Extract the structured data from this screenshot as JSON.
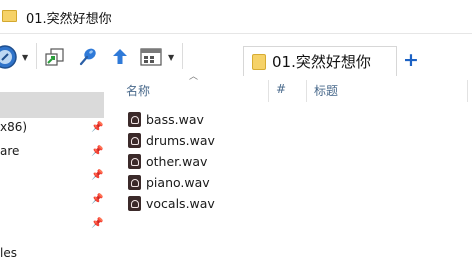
{
  "window": {
    "title": "01.突然好想你"
  },
  "tab": {
    "label": "01.突然好想你",
    "new_tab_symbol": "+"
  },
  "sidebar": {
    "items": [
      {
        "label": "x86)",
        "pinned": true
      },
      {
        "label": "are",
        "pinned": true
      },
      {
        "label": "",
        "pinned": true
      },
      {
        "label": "",
        "pinned": true
      },
      {
        "label": "",
        "pinned": true
      },
      {
        "label": "les",
        "pinned": false
      }
    ]
  },
  "columns": {
    "name": "名称",
    "number": "#",
    "title": "标题"
  },
  "files": [
    {
      "name": "bass.wav"
    },
    {
      "name": "drums.wav"
    },
    {
      "name": "other.wav"
    },
    {
      "name": "piano.wav"
    },
    {
      "name": "vocals.wav"
    }
  ],
  "colors": {
    "accent": "#1c62c4",
    "folder": "#f6d268",
    "selection": "#dadada"
  }
}
